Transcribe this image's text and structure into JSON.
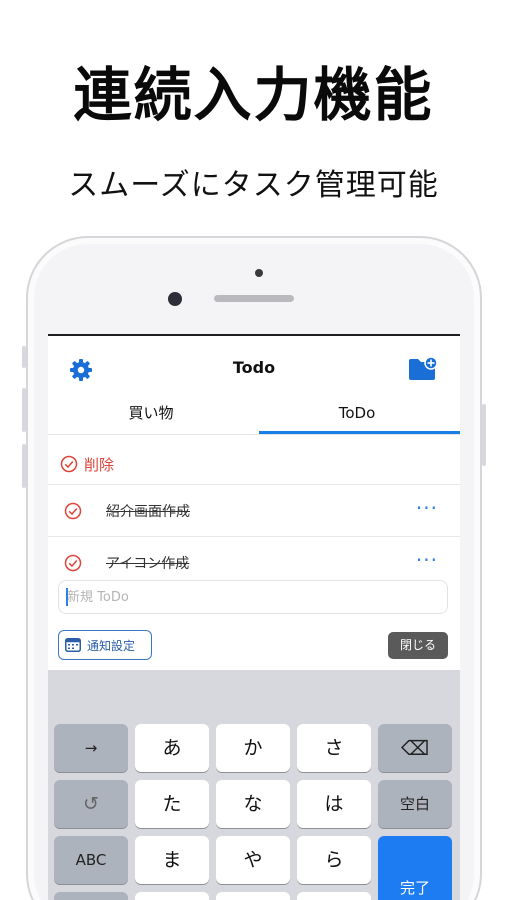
{
  "headline": "連続入力機能",
  "subheadline": "スムーズにタスク管理可能",
  "app": {
    "title": "Todo",
    "tabs": [
      {
        "label": "買い物",
        "selected": false
      },
      {
        "label": "ToDo",
        "selected": true
      }
    ],
    "delete_label": "削除",
    "tasks": [
      {
        "label": "紹介画面作成",
        "done": true,
        "more": "···"
      },
      {
        "label": "アイコン作成",
        "done": true,
        "more": "···"
      }
    ],
    "new_input": {
      "value": "",
      "placeholder": "新規 ToDo"
    },
    "notification_button": "通知設定",
    "close_button": "閉じる",
    "accent_color": "#1a7ee8",
    "delete_color": "#e0443a",
    "icons": [
      "gear-icon",
      "add-folder-icon",
      "check-circle-icon",
      "more-icon",
      "calendar-icon"
    ]
  },
  "keyboard": {
    "keys": {
      "next": "→",
      "a": "あ",
      "ka": "か",
      "sa": "さ",
      "delete": "⌫",
      "undo": "↺",
      "ta": "た",
      "na": "な",
      "ha": "は",
      "space": "空白",
      "abc": "ABC",
      "ma": "ま",
      "ya": "や",
      "ra": "ら",
      "done": "完了"
    }
  }
}
